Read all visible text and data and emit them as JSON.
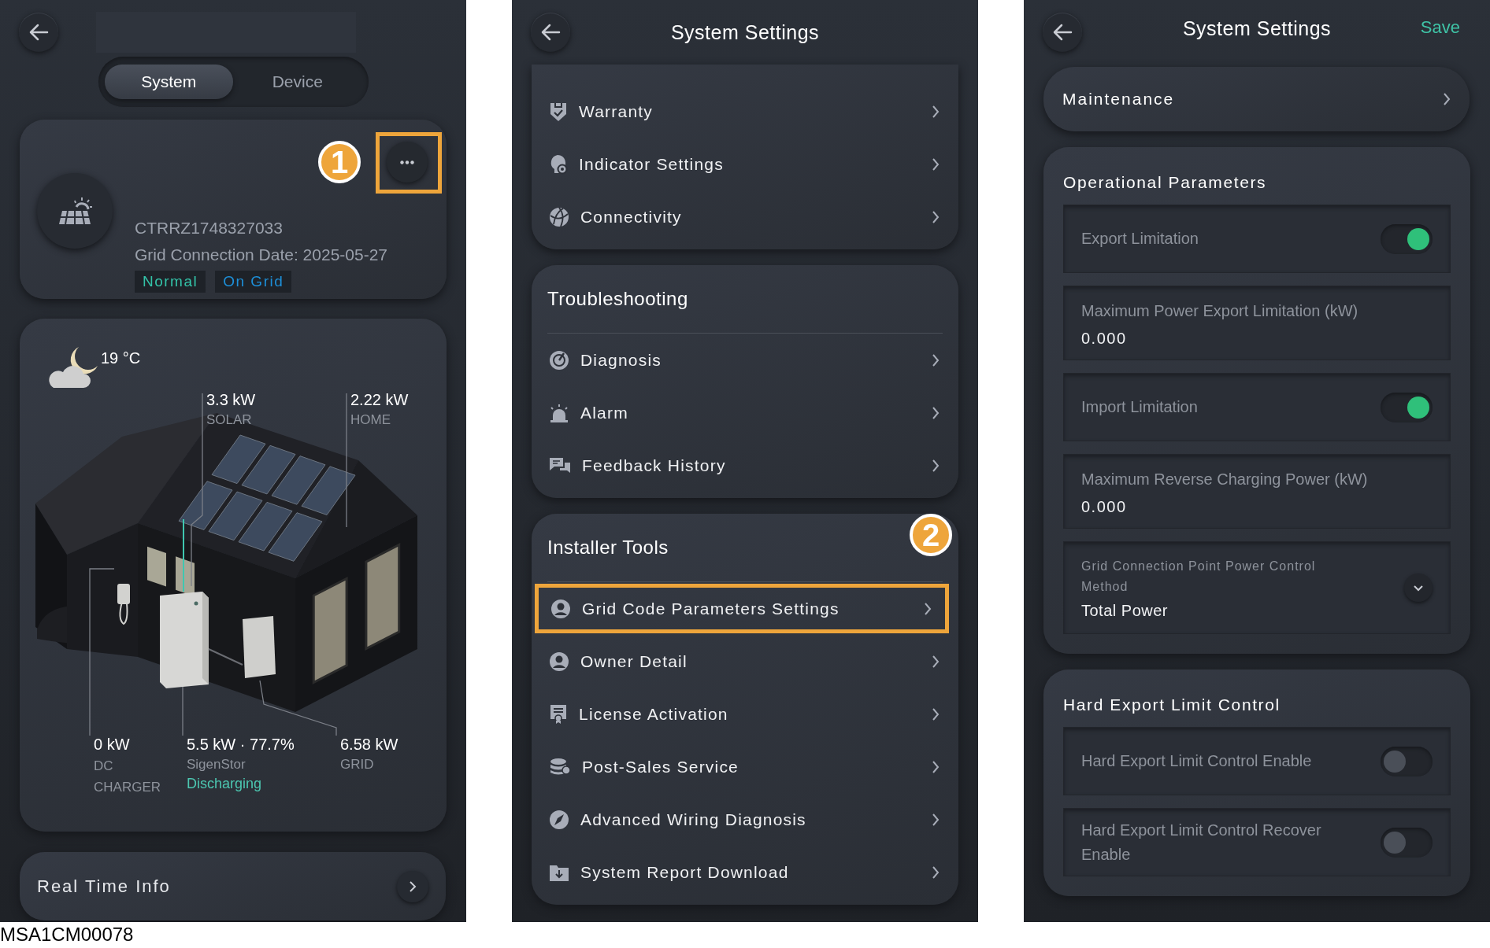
{
  "overview": {
    "tabs": [
      {
        "label": "System",
        "selected": true
      },
      {
        "label": "Device",
        "selected": false
      }
    ],
    "device": {
      "serial": "CTRRZ1748327033",
      "date": "Grid Connection Date: 2025-05-27",
      "tags": [
        {
          "label": "Normal",
          "color": "#33c3a8"
        },
        {
          "label": "On Grid",
          "color": "#1d8fd8"
        }
      ]
    },
    "callout": "1",
    "weather": {
      "temperature": "19 °C"
    },
    "flows": [
      {
        "kind": "solar",
        "value": "3.3 kW",
        "label": "SOLAR"
      },
      {
        "kind": "home",
        "value": "2.22 kW",
        "label": "HOME"
      },
      {
        "kind": "charger",
        "value": "0 kW",
        "label": "DC CHARGER"
      },
      {
        "kind": "battery",
        "value": "5.5 kW · 77.7%",
        "label": "SigenStor",
        "status": "Discharging"
      },
      {
        "kind": "grid",
        "value": "6.58 kW",
        "label": "GRID"
      }
    ],
    "real_time_info": "Real Time Info"
  },
  "menu": {
    "title": "System Settings",
    "groups": [
      {
        "items": [
          {
            "label": "Warranty",
            "highlighted": false
          },
          {
            "label": "Indicator Settings",
            "highlighted": false
          },
          {
            "label": "Connectivity",
            "highlighted": false
          }
        ]
      },
      {
        "title": "Troubleshooting",
        "items": [
          {
            "label": "Diagnosis",
            "highlighted": false
          },
          {
            "label": "Alarm",
            "highlighted": false
          },
          {
            "label": "Feedback History",
            "highlighted": false
          }
        ]
      },
      {
        "title": "Installer Tools",
        "callout": "2",
        "items": [
          {
            "label": "Grid Code Parameters Settings",
            "highlighted": true
          },
          {
            "label": "Owner Detail",
            "highlighted": false
          },
          {
            "label": "License Activation",
            "highlighted": false
          },
          {
            "label": "Post-Sales Service",
            "highlighted": false
          },
          {
            "label": "Advanced Wiring Diagnosis",
            "highlighted": false
          },
          {
            "label": "System Report Download",
            "highlighted": false
          }
        ]
      }
    ]
  },
  "settings": {
    "title": "System Settings",
    "save": "Save",
    "maintenance": "Maintenance",
    "sections": [
      {
        "title": "Operational Parameters",
        "rows": [
          {
            "kind": "toggle",
            "label": "Export Limitation",
            "on": true
          },
          {
            "kind": "input",
            "label": "Maximum Power Export Limitation (kW)",
            "value": "0.000"
          },
          {
            "kind": "toggle",
            "label": "Import Limitation",
            "on": true
          },
          {
            "kind": "input",
            "label": "Maximum Reverse Charging Power (kW)",
            "value": "0.000"
          },
          {
            "kind": "select",
            "label": "Grid Connection Point Power Control Method",
            "value": "Total Power"
          }
        ]
      },
      {
        "title": "Hard Export Limit Control",
        "rows": [
          {
            "kind": "toggle",
            "label": "Hard Export Limit Control Enable",
            "on": false
          },
          {
            "kind": "toggle",
            "label": "Hard Export Limit Control Recover Enable",
            "on": false
          }
        ]
      }
    ]
  },
  "figure_code": "MSA1CM00078"
}
